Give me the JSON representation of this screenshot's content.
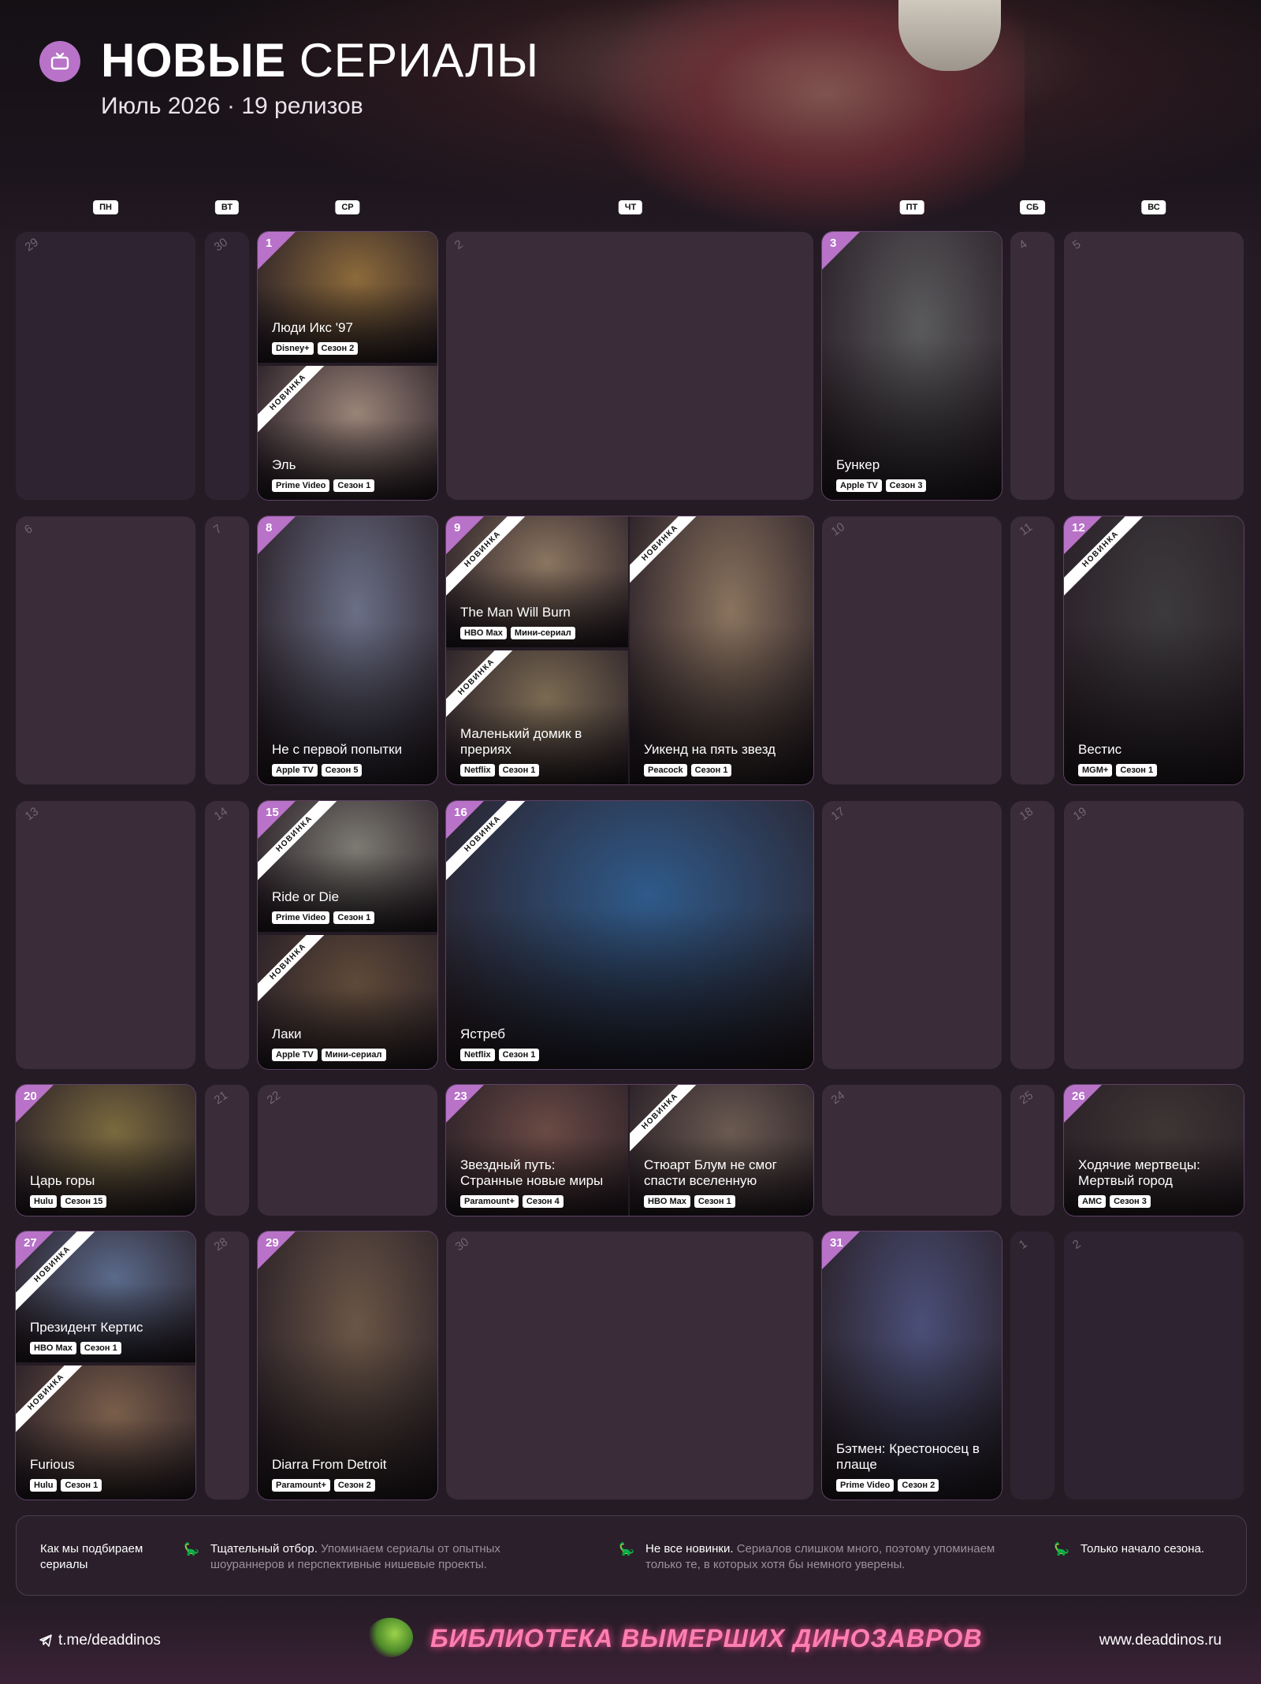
{
  "header": {
    "title_bold": "НОВЫЕ",
    "title_light": "СЕРИАЛЫ",
    "month": "Июль 2026",
    "separator": "·",
    "releases": "19 релизов"
  },
  "weekdays": [
    "ПН",
    "ВТ",
    "СР",
    "ЧТ",
    "ПТ",
    "СБ",
    "ВС"
  ],
  "empty_days": [
    "29",
    "30",
    "2",
    "4",
    "5",
    "6",
    "7",
    "10",
    "11",
    "13",
    "14",
    "17",
    "18",
    "19",
    "21",
    "22",
    "24",
    "25",
    "28",
    "30",
    "1",
    "2"
  ],
  "badge_new": "НОВИНКА",
  "shows": [
    {
      "day": "1",
      "title": "Люди Икс '97",
      "platform": "Disney+",
      "season": "Сезон 2",
      "new": false,
      "color": "#8c6a3a"
    },
    {
      "day": "",
      "title": "Эль",
      "platform": "Prime Video",
      "season": "Сезон 1",
      "new": true,
      "color": "#9a8478"
    },
    {
      "day": "3",
      "title": "Бункер",
      "platform": "Apple TV",
      "season": "Сезон 3",
      "new": false,
      "color": "#5a5a5c"
    },
    {
      "day": "8",
      "title": "Не с первой попытки",
      "platform": "Apple TV",
      "season": "Сезон 5",
      "new": false,
      "color": "#6a6f86"
    },
    {
      "day": "9",
      "title": "The Man Will Burn",
      "platform": "HBO Max",
      "season": "Мини-сериал",
      "new": true,
      "color": "#8b7560"
    },
    {
      "day": "",
      "title": "Маленький домик в прериях",
      "platform": "Netflix",
      "season": "Сезон 1",
      "new": true,
      "color": "#7a6a52"
    },
    {
      "day": "",
      "title": "Уикенд на пять звезд",
      "platform": "Peacock",
      "season": "Сезон 1",
      "new": true,
      "color": "#8a735e"
    },
    {
      "day": "12",
      "title": "Вестис",
      "platform": "MGM+",
      "season": "Сезон 1",
      "new": true,
      "color": "#3c3a3c"
    },
    {
      "day": "15",
      "title": "Ride or Die",
      "platform": "Prime Video",
      "season": "Сезон 1",
      "new": true,
      "color": "#7c7a72"
    },
    {
      "day": "",
      "title": "Лаки",
      "platform": "Apple TV",
      "season": "Мини-сериал",
      "new": true,
      "color": "#5e4a38"
    },
    {
      "day": "16",
      "title": "Ястреб",
      "platform": "Netflix",
      "season": "Сезон 1",
      "new": true,
      "color": "#2f5a8a"
    },
    {
      "day": "20",
      "title": "Царь горы",
      "platform": "Hulu",
      "season": "Сезон 15",
      "new": false,
      "color": "#7a6a3e"
    },
    {
      "day": "23",
      "title": "Звездный путь: Странные новые миры",
      "platform": "Paramount+",
      "season": "Сезон 4",
      "new": false,
      "color": "#6a4a44"
    },
    {
      "day": "",
      "title": "Стюарт Блум не смог спасти вселенную",
      "platform": "HBO Max",
      "season": "Сезон 1",
      "new": true,
      "color": "#6a5a50"
    },
    {
      "day": "26",
      "title": "Ходячие мертвецы: Мертвый город",
      "platform": "AMC",
      "season": "Сезон 3",
      "new": false,
      "color": "#3e3634"
    },
    {
      "day": "27",
      "title": "Президент Кертис",
      "platform": "HBO Max",
      "season": "Сезон 1",
      "new": true,
      "color": "#5a6a8a"
    },
    {
      "day": "",
      "title": "Furious",
      "platform": "Hulu",
      "season": "Сезон 1",
      "new": true,
      "color": "#7a5e4a"
    },
    {
      "day": "29",
      "title": "Diarra From Detroit",
      "platform": "Paramount+",
      "season": "Сезон 2",
      "new": false,
      "color": "#6a5646"
    },
    {
      "day": "31",
      "title": "Бэтмен: Крестоносец в плаще",
      "platform": "Prime Video",
      "season": "Сезон 2",
      "new": false,
      "color": "#4a4f78"
    }
  ],
  "footer_info": {
    "heading": "Как мы подбираем сериалы",
    "item1_bold": "Тщательный отбор.",
    "item1_text": "Упоминаем сериалы от опытных шоураннеров и перспективные нишевые проекты.",
    "item2_bold": "Не все новинки.",
    "item2_text": "Сериалов слишком много, поэтому упоминаем только те, в которых хотя бы немного уверены.",
    "item3_bold": "Только начало сезона."
  },
  "bottom": {
    "telegram": "t.me/deaddinos",
    "brand": "БИБЛИОТЕКА ВЫМЕРШИХ ДИНОЗАВРОВ",
    "website": "www.deaddinos.ru"
  }
}
